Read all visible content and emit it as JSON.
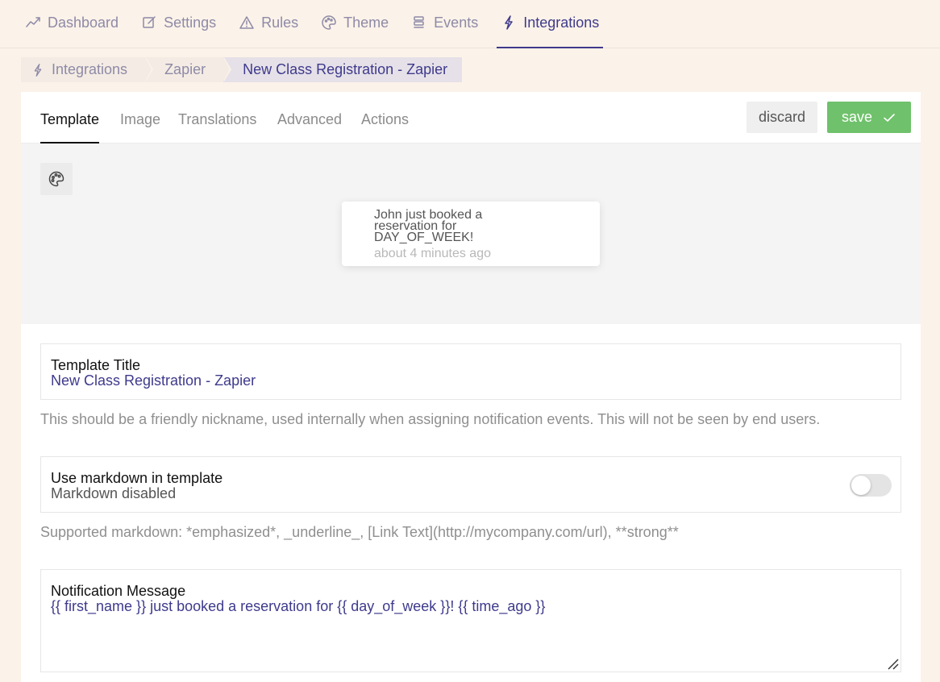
{
  "nav": {
    "items": [
      {
        "label": "Dashboard",
        "icon": "chart-line-icon"
      },
      {
        "label": "Settings",
        "icon": "edit-icon"
      },
      {
        "label": "Rules",
        "icon": "warning-icon"
      },
      {
        "label": "Theme",
        "icon": "palette-icon"
      },
      {
        "label": "Events",
        "icon": "list-icon"
      },
      {
        "label": "Integrations",
        "icon": "bolt-icon",
        "active": true
      }
    ]
  },
  "breadcrumb": {
    "items": [
      "Integrations",
      "Zapier",
      "New Class Registration - Zapier"
    ]
  },
  "tabs": {
    "items": [
      "Template",
      "Image",
      "Translations",
      "Advanced",
      "Actions"
    ],
    "active": "Template"
  },
  "actions": {
    "discard_label": "discard",
    "save_label": "save"
  },
  "preview": {
    "message": "John just booked a reservation for DAY_OF_WEEK!",
    "time": "about 4 minutes ago"
  },
  "fields": {
    "title": {
      "label": "Template Title",
      "value": "New Class Registration - Zapier",
      "help": "This should be a friendly nickname, used internally when assigning notification events. This will not be seen by end users."
    },
    "markdown": {
      "label": "Use markdown in template",
      "status": "Markdown disabled",
      "enabled": false,
      "help": "Supported markdown: *emphasized*, _underline_, [Link Text](http://mycompany.com/url), **strong**"
    },
    "message": {
      "label": "Notification Message",
      "value": "{{ first_name }} just booked a reservation for {{ day_of_week }}! {{ time_ago }}"
    }
  }
}
